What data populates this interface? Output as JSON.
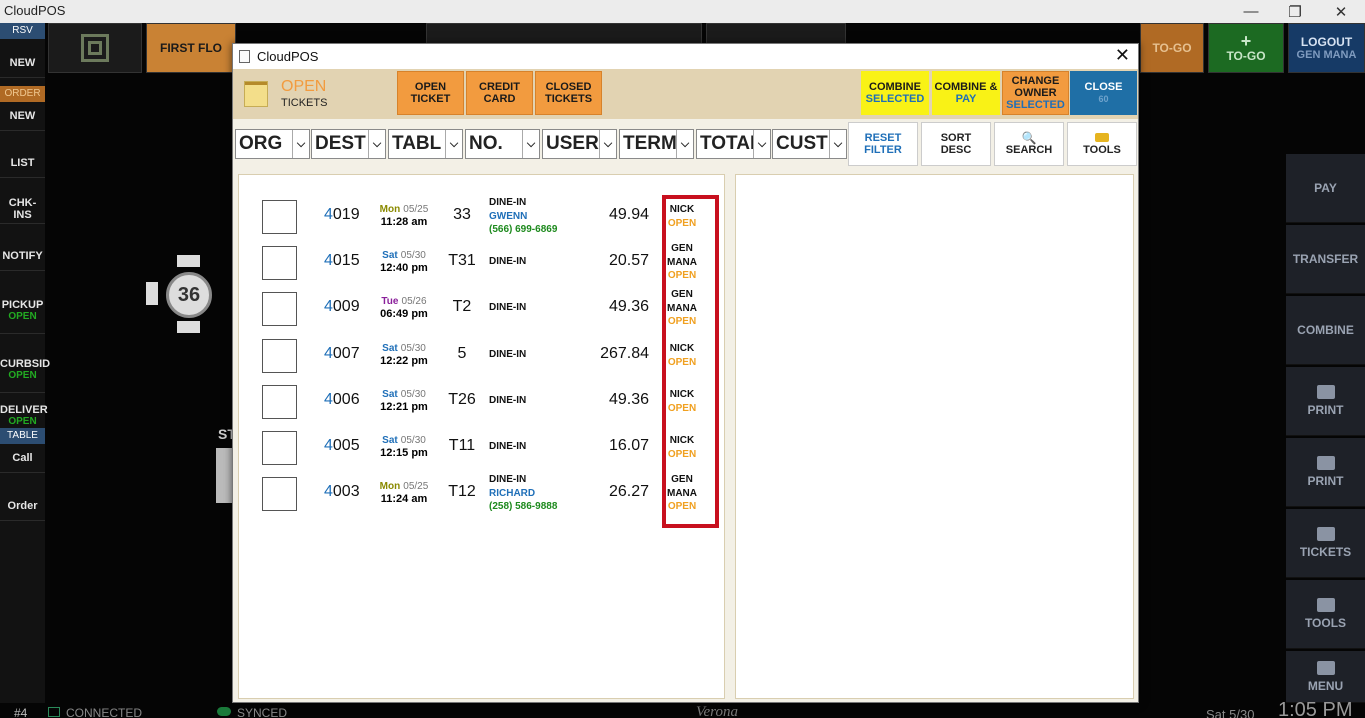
{
  "window": {
    "title": "CloudPOS",
    "min": "—",
    "restore": "❐",
    "close": "✕"
  },
  "left_sidebar": {
    "rsv_header": "RSV",
    "order_header": "ORDER",
    "table_header": "TABLE",
    "items": [
      {
        "label": "NEW",
        "sub": ""
      },
      {
        "label": "NEW",
        "sub": ""
      },
      {
        "label": "LIST",
        "sub": ""
      },
      {
        "label": "CHK-INS",
        "sub": ""
      },
      {
        "label": "NOTIFY",
        "sub": ""
      },
      {
        "label": "PICKUP",
        "sub": "OPEN"
      },
      {
        "label": "CURBSID",
        "sub": "OPEN"
      },
      {
        "label": "DELIVER",
        "sub": "OPEN"
      },
      {
        "label": "Call",
        "sub": ""
      },
      {
        "label": "Order",
        "sub": ""
      }
    ]
  },
  "top_bar": {
    "first_floor": "FIRST FLO",
    "togo1": "TO-GO",
    "togo2": "TO-GO",
    "logout": "LOGOUT",
    "logout_user": "GEN MANA"
  },
  "right_sidebar": [
    "PAY",
    "TRANSFER",
    "COMBINE",
    "PRINT",
    "PRINT",
    "TICKETS",
    "TOOLS",
    "MENU"
  ],
  "floor": {
    "table_number": "36",
    "fragment": "ST"
  },
  "bottom_bar": {
    "station": "#4",
    "connected": "CONNECTED",
    "synced": "SYNCED",
    "brand": "Verona",
    "date": "Sat 5/30",
    "time": "1:05 PM"
  },
  "dialog": {
    "title": "CloudPOS",
    "close_x": "✕",
    "header": {
      "status": "OPEN",
      "tickets": "TICKETS",
      "open_ticket": [
        "OPEN",
        "TICKET"
      ],
      "credit_card": [
        "CREDIT",
        "CARD"
      ],
      "closed_tickets": [
        "CLOSED",
        "TICKETS"
      ],
      "combine_selected": [
        "COMBINE",
        "SELECTED"
      ],
      "combine_pay": [
        "COMBINE &",
        "PAY"
      ],
      "change_owner": [
        "CHANGE",
        "OWNER",
        "SELECTED"
      ],
      "close": [
        "CLOSE",
        "60"
      ]
    },
    "filters": [
      "ORG",
      "DEST",
      "TABL",
      "NO.",
      "USER",
      "TERM",
      "TOTAI",
      "CUST"
    ],
    "filter_buttons": {
      "reset": [
        "RESET",
        "FILTER"
      ],
      "sort": [
        "SORT",
        "DESC"
      ],
      "search": "SEARCH",
      "tools": "TOOLS"
    },
    "tickets": [
      {
        "no_prefix": "4",
        "no_rest": "019",
        "day": "Mon",
        "day_color": "#8a8a00",
        "md": "05/25",
        "time": "11:28 am",
        "table": "33",
        "dest": "DINE-IN",
        "customer": "GWENN",
        "phone": "(566) 699-6869",
        "amount": "49.94",
        "owner": [
          "NICK"
        ],
        "status": "OPEN"
      },
      {
        "no_prefix": "4",
        "no_rest": "015",
        "day": "Sat",
        "day_color": "#1f6fb8",
        "md": "05/30",
        "time": "12:40 pm",
        "table": "T31",
        "dest": "DINE-IN",
        "customer": "",
        "phone": "",
        "amount": "20.57",
        "owner": [
          "GEN",
          "MANA"
        ],
        "status": "OPEN"
      },
      {
        "no_prefix": "4",
        "no_rest": "009",
        "day": "Tue",
        "day_color": "#8a1f9a",
        "md": "05/26",
        "time": "06:49 pm",
        "table": "T2",
        "dest": "DINE-IN",
        "customer": "",
        "phone": "",
        "amount": "49.36",
        "owner": [
          "GEN",
          "MANA"
        ],
        "status": "OPEN"
      },
      {
        "no_prefix": "4",
        "no_rest": "007",
        "day": "Sat",
        "day_color": "#1f6fb8",
        "md": "05/30",
        "time": "12:22 pm",
        "table": "5",
        "dest": "DINE-IN",
        "customer": "",
        "phone": "",
        "amount": "267.84",
        "owner": [
          "NICK"
        ],
        "status": "OPEN"
      },
      {
        "no_prefix": "4",
        "no_rest": "006",
        "day": "Sat",
        "day_color": "#1f6fb8",
        "md": "05/30",
        "time": "12:21 pm",
        "table": "T26",
        "dest": "DINE-IN",
        "customer": "",
        "phone": "",
        "amount": "49.36",
        "owner": [
          "NICK"
        ],
        "status": "OPEN"
      },
      {
        "no_prefix": "4",
        "no_rest": "005",
        "day": "Sat",
        "day_color": "#1f6fb8",
        "md": "05/30",
        "time": "12:15 pm",
        "table": "T11",
        "dest": "DINE-IN",
        "customer": "",
        "phone": "",
        "amount": "16.07",
        "owner": [
          "NICK"
        ],
        "status": "OPEN"
      },
      {
        "no_prefix": "4",
        "no_rest": "003",
        "day": "Mon",
        "day_color": "#8a8a00",
        "md": "05/25",
        "time": "11:24 am",
        "table": "T12",
        "dest": "DINE-IN",
        "customer": "RICHARD",
        "phone": "(258) 586-9888",
        "amount": "26.27",
        "owner": [
          "GEN",
          "MANA"
        ],
        "status": "OPEN"
      }
    ]
  }
}
